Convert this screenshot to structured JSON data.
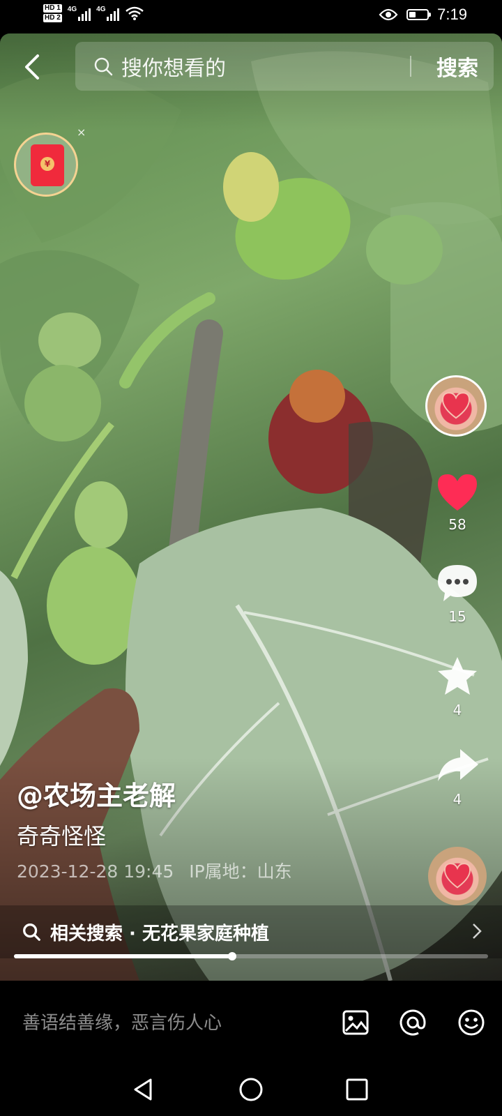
{
  "status_bar": {
    "hd1": "HD 1",
    "hd2": "HD 2",
    "signal1": "4G",
    "signal2": "4G",
    "time": "7:19",
    "battery_level": 0.35
  },
  "search": {
    "placeholder": "搜你想看的",
    "button": "搜索"
  },
  "red_packet": {
    "close": "×",
    "coin": "¥"
  },
  "actions": {
    "likes": "58",
    "comments": "15",
    "favorites": "4",
    "shares": "4"
  },
  "post": {
    "author": "@农场主老解",
    "caption": "奇奇怪怪",
    "datetime": "2023-12-28 19:45",
    "location": "IP属地：山东"
  },
  "related_search": {
    "label": "相关搜索 · 无花果家庭种植"
  },
  "progress": {
    "fraction": 0.46
  },
  "comment_bar": {
    "placeholder": "善语结善缘，恶言伤人心"
  },
  "colors": {
    "like_red": "#fe2c55",
    "red_packet": "#f02a3c",
    "red_packet_ring": "#f5d392"
  }
}
